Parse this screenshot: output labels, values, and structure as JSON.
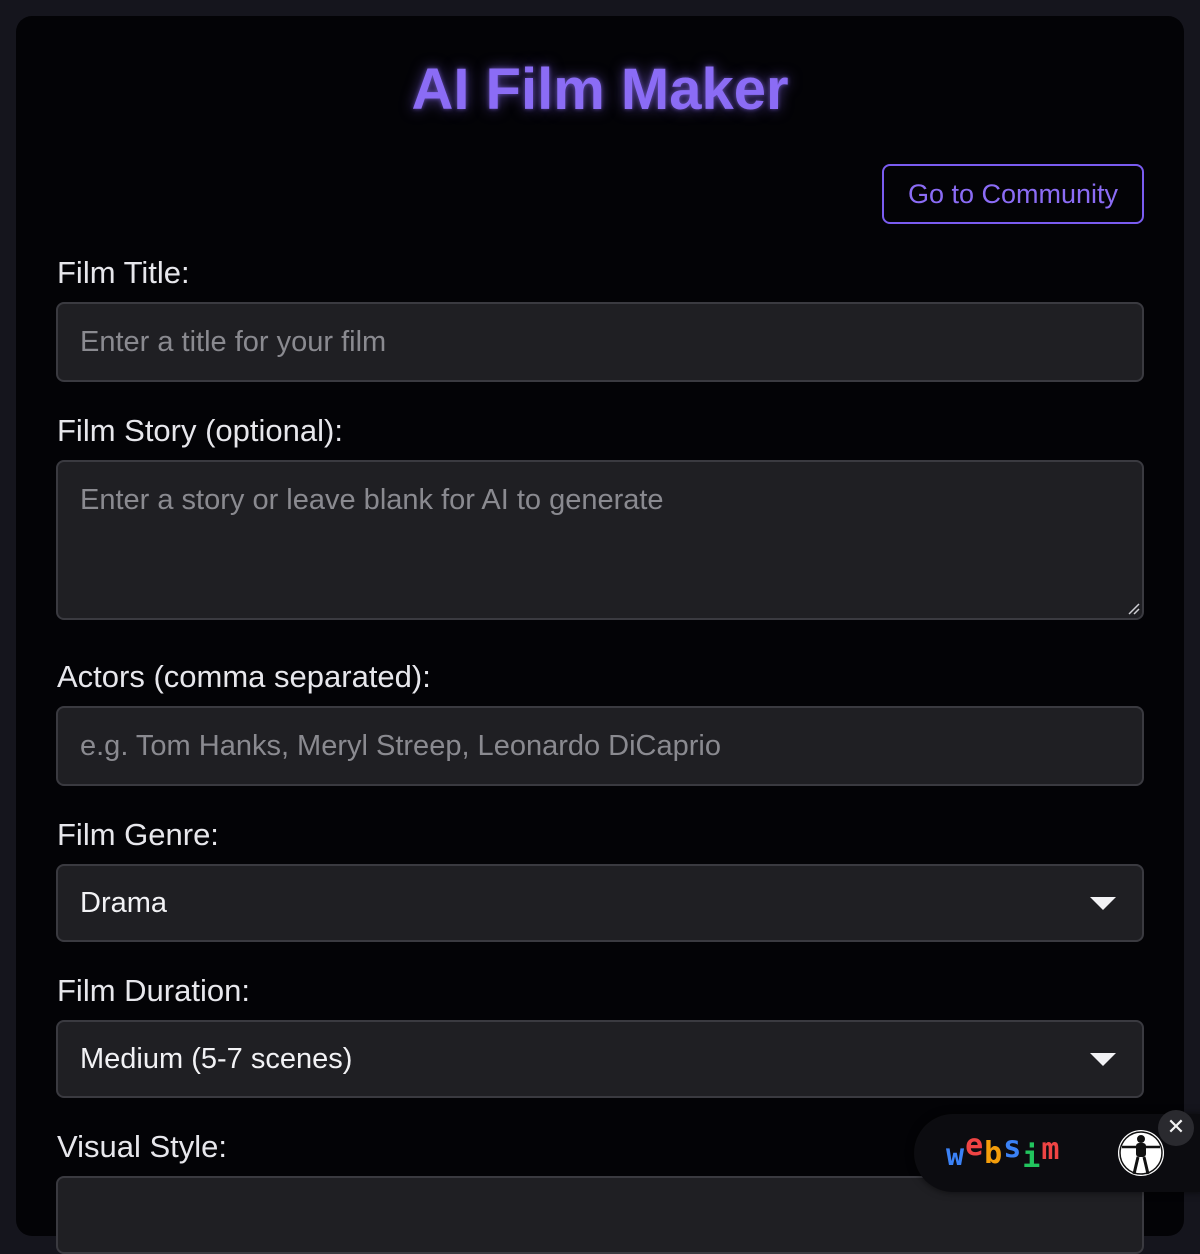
{
  "header": {
    "title": "AI Film Maker",
    "community_button": "Go to Community"
  },
  "form": {
    "title_label": "Film Title:",
    "title_placeholder": "Enter a title for your film",
    "title_value": "",
    "story_label": "Film Story (optional):",
    "story_placeholder": "Enter a story or leave blank for AI to generate",
    "story_value": "",
    "actors_label": "Actors (comma separated):",
    "actors_placeholder": "e.g. Tom Hanks, Meryl Streep, Leonardo DiCaprio",
    "actors_value": "",
    "genre_label": "Film Genre:",
    "genre_selected": "Drama",
    "duration_label": "Film Duration:",
    "duration_selected": "Medium (5-7 scenes)",
    "style_label": "Visual Style:"
  },
  "badge": {
    "logo_letters": [
      "w",
      "e",
      "b",
      "s",
      "i",
      "m"
    ],
    "close_symbol": "✕"
  },
  "colors": {
    "accent": "#8b6cf5",
    "card_bg": "#030306",
    "page_bg": "#15151d",
    "field_bg": "#1f1f23",
    "field_border": "#3a3a40",
    "text": "#e7e7ec",
    "placeholder": "#8a8a90"
  },
  "icons": {
    "select_caret": "chevron-down-icon",
    "resize": "resize-grip-icon",
    "avatar": "vitruvian-man-icon",
    "close": "close-icon"
  }
}
